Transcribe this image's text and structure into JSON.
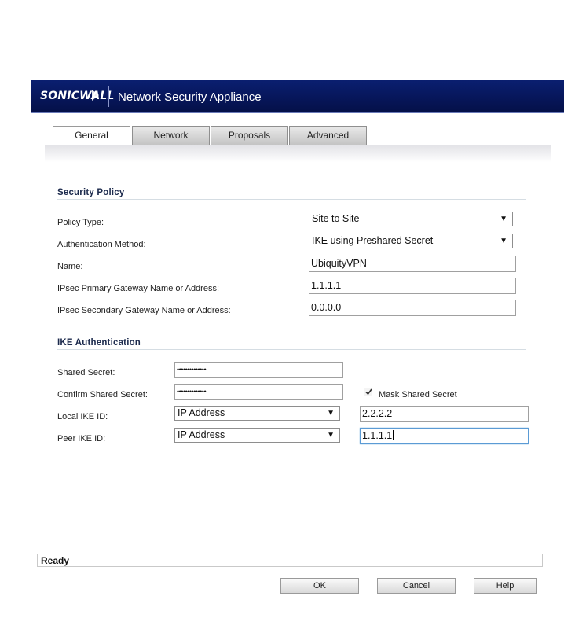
{
  "header": {
    "logo_text": "SONICWALL",
    "title": "Network Security Appliance"
  },
  "tabs": [
    {
      "label": "General",
      "active": true
    },
    {
      "label": "Network",
      "active": false
    },
    {
      "label": "Proposals",
      "active": false
    },
    {
      "label": "Advanced",
      "active": false
    }
  ],
  "security_policy": {
    "section_title": "Security Policy",
    "policy_type": {
      "label": "Policy Type:",
      "value": "Site to Site"
    },
    "auth_method": {
      "label": "Authentication Method:",
      "value": "IKE using Preshared Secret"
    },
    "name": {
      "label": "Name:",
      "value": "UbiquityVPN"
    },
    "primary_gateway": {
      "label": "IPsec Primary Gateway Name or Address:",
      "value": "1.1.1.1"
    },
    "secondary_gateway": {
      "label": "IPsec Secondary Gateway Name or Address:",
      "value": "0.0.0.0"
    }
  },
  "ike_auth": {
    "section_title": "IKE Authentication",
    "shared_secret": {
      "label": "Shared Secret:",
      "value": "••••••••••••••"
    },
    "confirm_secret": {
      "label": "Confirm Shared Secret:",
      "value": "••••••••••••••"
    },
    "mask_secret": {
      "label": "Mask Shared Secret",
      "checked": true
    },
    "local_ike_id": {
      "label": "Local IKE ID:",
      "type": "IP Address",
      "value": "2.2.2.2"
    },
    "peer_ike_id": {
      "label": "Peer IKE ID:",
      "type": "IP Address",
      "value": "1.1.1.1"
    }
  },
  "status": {
    "text": "Ready"
  },
  "buttons": {
    "ok": "OK",
    "cancel": "Cancel",
    "help": "Help"
  },
  "colors": {
    "banner": "#07165a",
    "section_title": "#1c2a4d",
    "focus_border": "#5b9bd5"
  },
  "icons": {
    "dropdown": "chevron-down-icon",
    "checkbox": "checkmark-icon",
    "logo": "sonicwall-logo-icon"
  }
}
